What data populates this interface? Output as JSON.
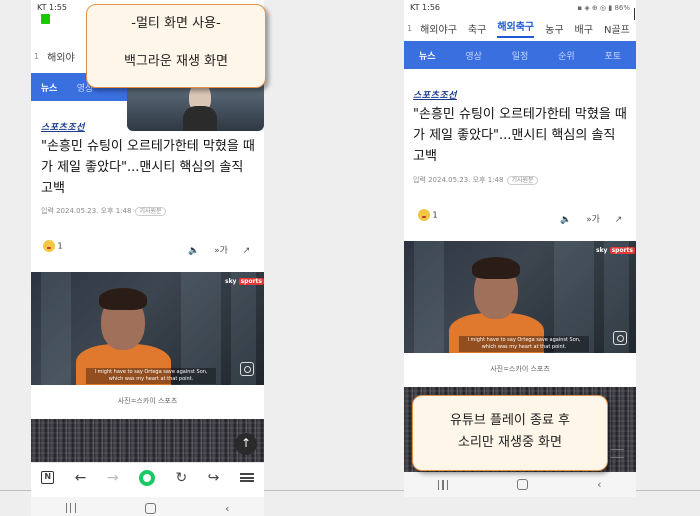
{
  "annotations": {
    "top_callout_line1": "-멀티 화면 사용-",
    "top_callout_line2": "백그라운 재생 화면",
    "bottom_callout_line1": "유튜브 플레이 종료 후",
    "bottom_callout_line2": "소리만 재생중 화면"
  },
  "left_phone": {
    "status_time": "KT 1:55",
    "section_tab_partial": "해외야",
    "section_num": "1",
    "sub_tab_active": "뉴스",
    "sub_tab_partial": "영상"
  },
  "right_phone": {
    "status_time": "KT 1:56",
    "status_battery": "86%",
    "section_num": "1",
    "section_tabs": [
      "해외야구",
      "축구",
      "해외축구",
      "농구",
      "배구",
      "N골프"
    ],
    "section_tab_active": "해외축구",
    "sub_tabs": [
      "뉴스",
      "영상",
      "일정",
      "순위",
      "포토"
    ],
    "sub_tab_active": "뉴스"
  },
  "article": {
    "brand": "스포츠조선",
    "headline": "\"손흥민 슈팅이 오르테가한테 막혔을 때가 제일 좋았다\"...맨시티 핵심의 솔직 고백",
    "date": "입력 2024.05.23. 오후 1:48",
    "source_badge": "기사원문",
    "reaction_count": "1",
    "tool_font": "가",
    "video_brand_sky": "sky",
    "video_brand_sports": "sports",
    "video_subtitle_line1": "I might have to say Ortega save against Son,",
    "video_subtitle_line2": "which was my heart at that point.",
    "photo_caption": "사진=스카이 스포츠"
  },
  "icons": {
    "scroll_top": "arrow-up-icon",
    "back": "arrow-left-icon",
    "forward": "arrow-right-icon",
    "refresh": "refresh-icon",
    "share": "share-icon",
    "menu": "menu-icon"
  },
  "colors": {
    "brand_blue": "#3a6fe0",
    "active_tab": "#1f5bd6",
    "naver_green": "#18c964",
    "callout_border": "#e4914a"
  }
}
